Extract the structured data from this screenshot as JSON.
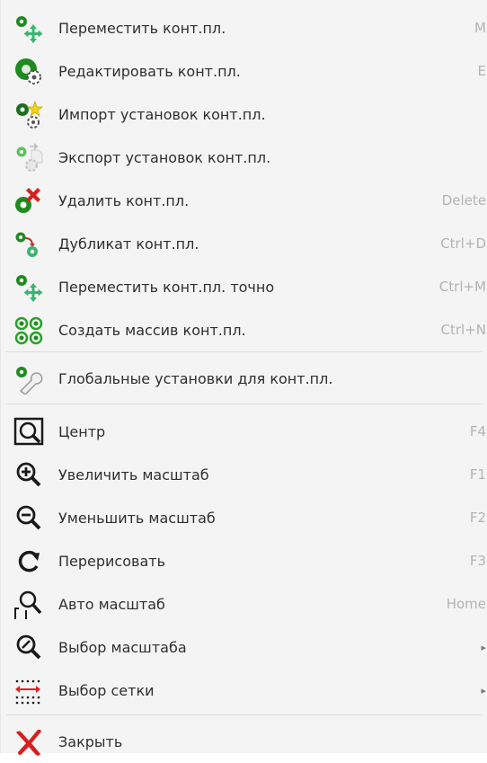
{
  "menu": {
    "items": [
      {
        "label": "Переместить конт.пл.",
        "shortcut": "M"
      },
      {
        "label": "Редактировать конт.пл.",
        "shortcut": "E"
      },
      {
        "label": "Импорт установок конт.пл.",
        "shortcut": ""
      },
      {
        "label": "Экспорт установок конт.пл.",
        "shortcut": ""
      },
      {
        "label": "Удалить конт.пл.",
        "shortcut": "Delete"
      },
      {
        "label": "Дубликат конт.пл.",
        "shortcut": "Ctrl+D"
      },
      {
        "label": "Переместить конт.пл. точно",
        "shortcut": "Ctrl+M"
      },
      {
        "label": "Создать массив конт.пл.",
        "shortcut": "Ctrl+N"
      },
      {
        "label": "Глобальные установки для конт.пл.",
        "shortcut": ""
      },
      {
        "label": "Центр",
        "shortcut": "F4"
      },
      {
        "label": "Увеличить масштаб",
        "shortcut": "F1"
      },
      {
        "label": "Уменьшить масштаб",
        "shortcut": "F2"
      },
      {
        "label": "Перерисовать",
        "shortcut": "F3"
      },
      {
        "label": "Авто масштаб",
        "shortcut": "Home"
      },
      {
        "label": "Выбор масштаба",
        "shortcut": ""
      },
      {
        "label": "Выбор сетки",
        "shortcut": ""
      },
      {
        "label": "Закрыть",
        "shortcut": ""
      }
    ],
    "submenu_arrow": "▸",
    "icons": [
      "pad-move-icon",
      "pad-edit-icon",
      "pad-import-settings-icon",
      "pad-export-settings-icon",
      "pad-delete-icon",
      "pad-duplicate-icon",
      "pad-move-exact-icon",
      "pad-array-icon",
      "pad-global-settings-icon",
      "zoom-center-icon",
      "zoom-in-icon",
      "zoom-out-icon",
      "redraw-icon",
      "zoom-auto-icon",
      "zoom-select-icon",
      "grid-select-icon",
      "close-icon"
    ],
    "colors": {
      "pad_green": "#1f8a1f",
      "move_green": "#3cb371",
      "delete_red": "#d42020",
      "grid_red": "#e02020"
    }
  }
}
